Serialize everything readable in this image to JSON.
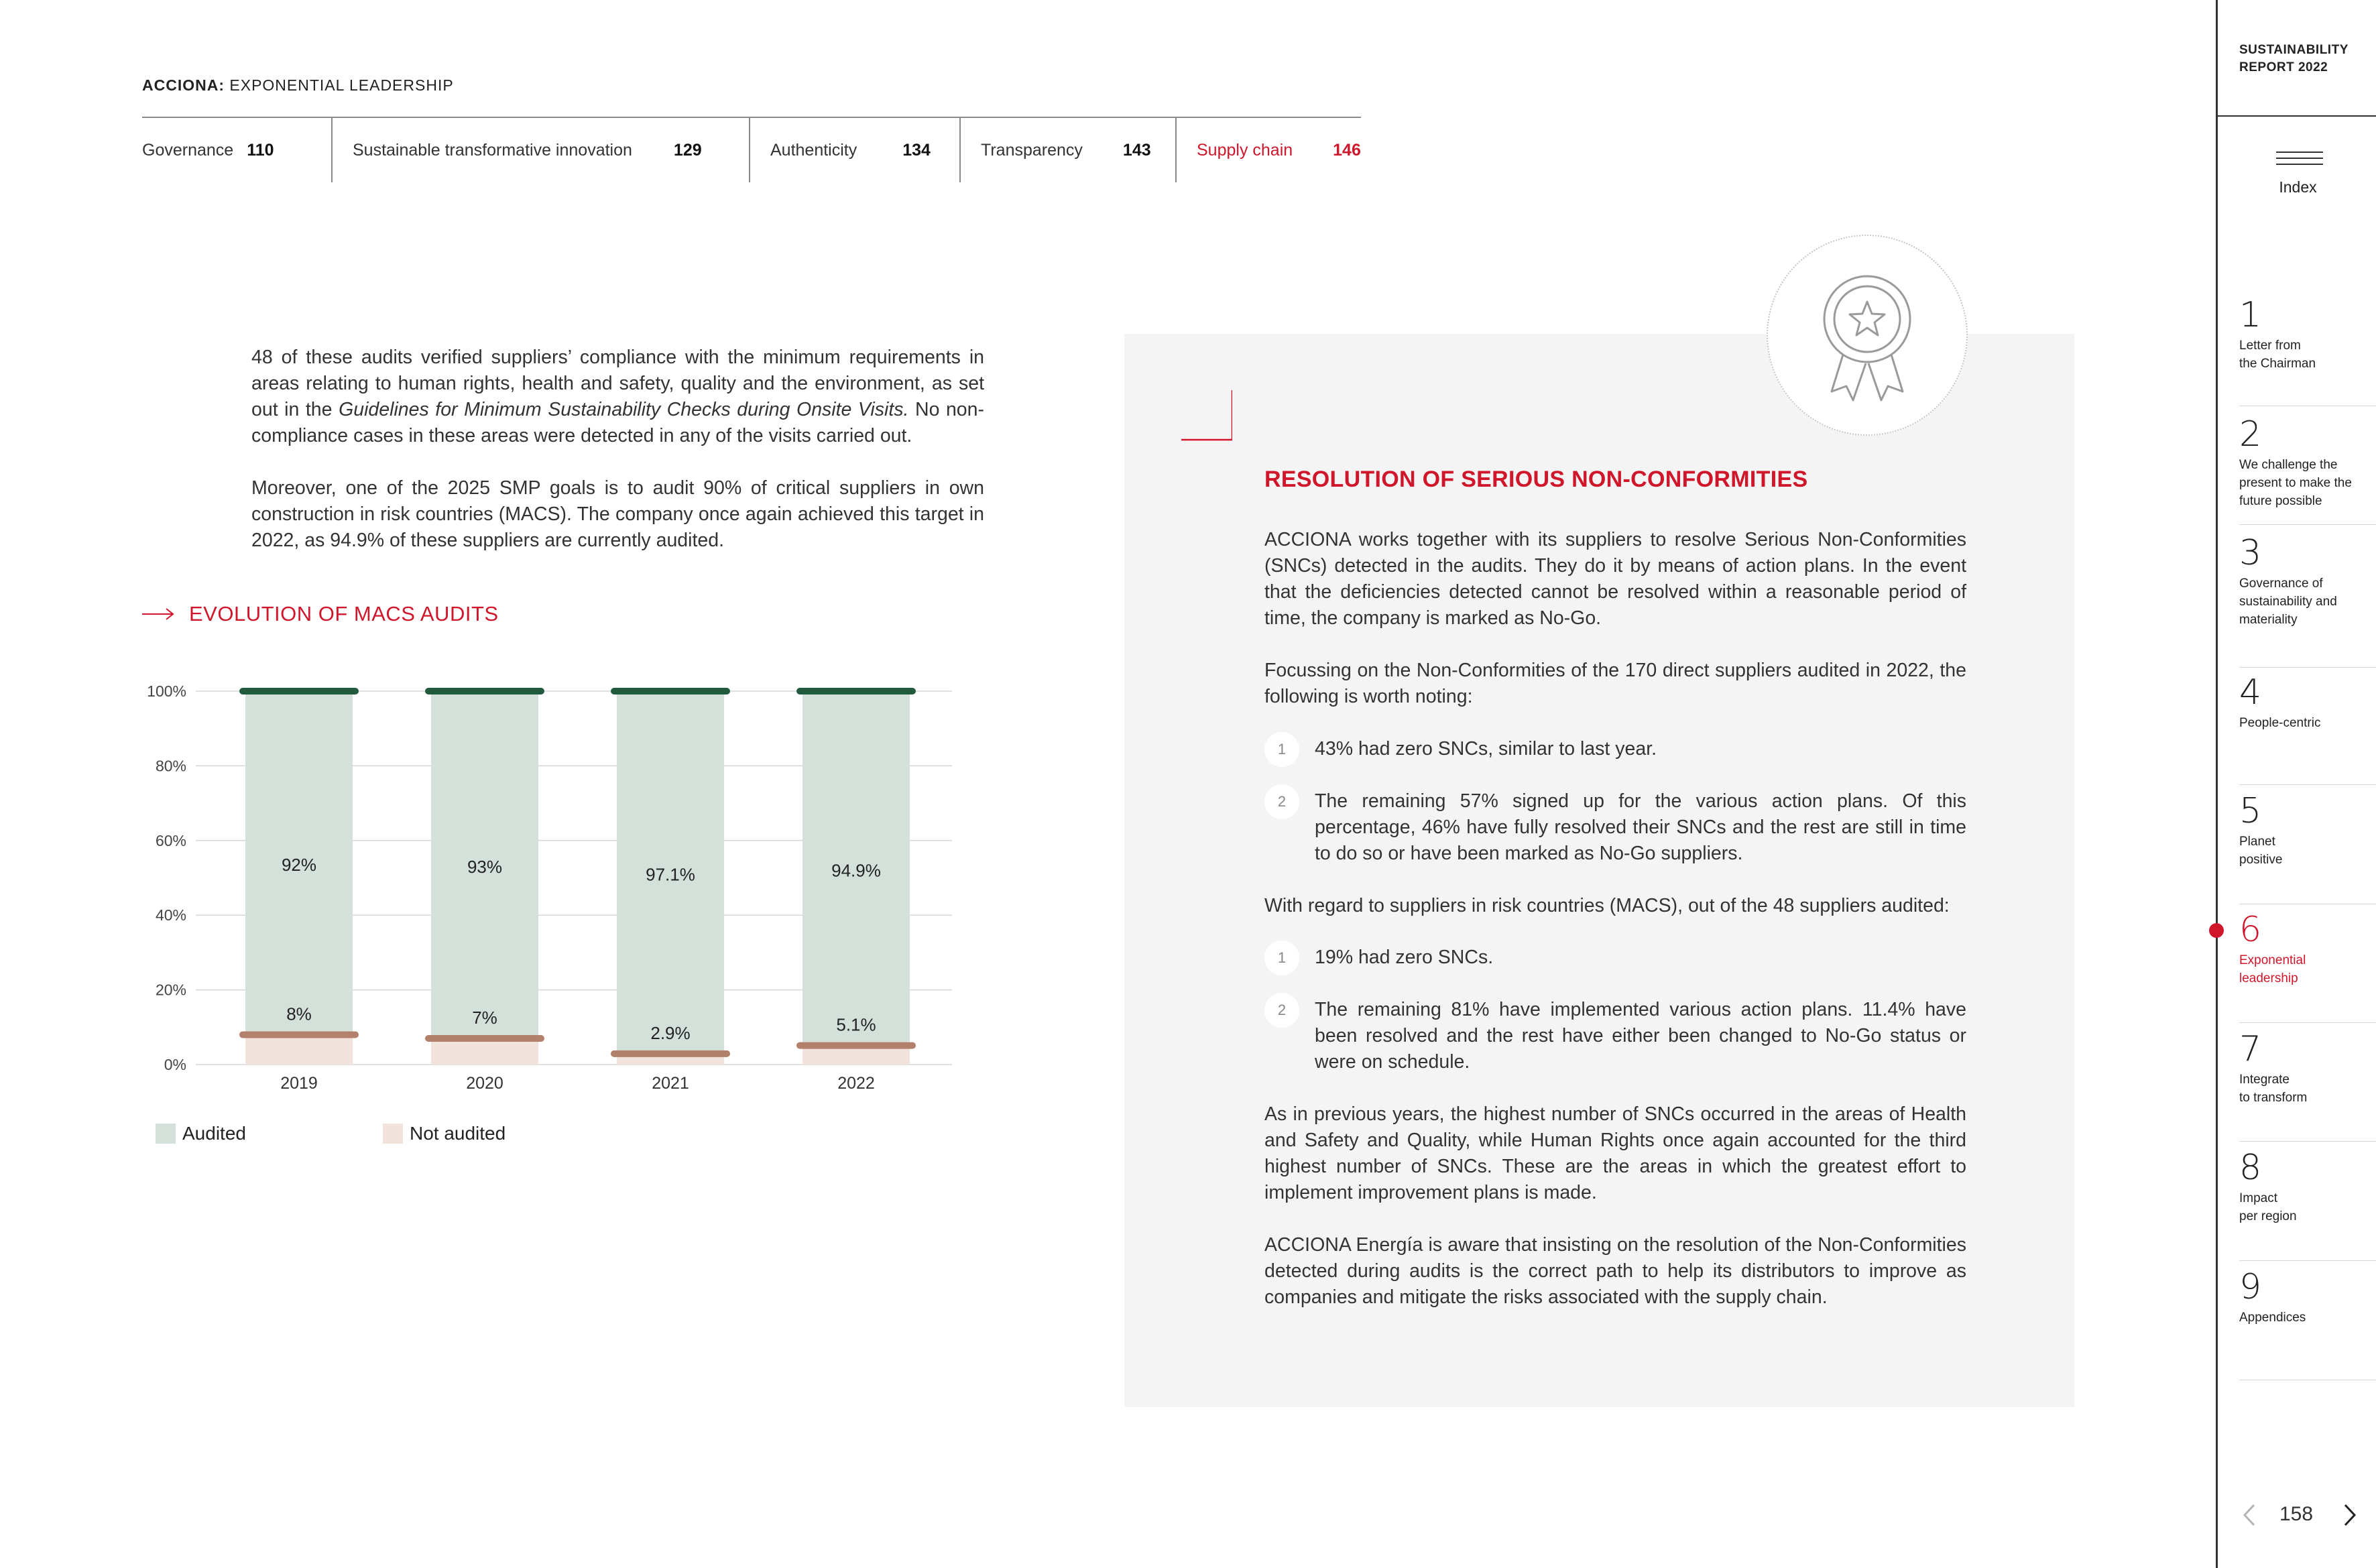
{
  "header": {
    "brand_bold": "ACCIONA:",
    "brand_rest": " EXPONENTIAL LEADERSHIP",
    "nav": [
      {
        "label": "Governance",
        "page": "110"
      },
      {
        "label": "Sustainable transformative innovation",
        "page": "129"
      },
      {
        "label": "Authenticity",
        "page": "134"
      },
      {
        "label": "Transparency",
        "page": "143"
      },
      {
        "label": "Supply chain",
        "page": "146"
      }
    ],
    "active_color": "#d0162b"
  },
  "left": {
    "para1_a": "48 of these audits verified suppliers’ compliance with the minimum requirements in areas relating to human rights, health and safety, quality and the environment, as set out in the ",
    "para1_italic": "Guidelines for Minimum Sustainability Checks during Onsite Visits.",
    "para1_b": " No non-compliance cases in these areas were detected in any of the visits carried out.",
    "para2": "Moreover, one of the 2025 SMP goals is to audit 90% of critical suppliers in own construction in risk countries (MACS). The company once again achieved this target in 2022, as 94.9% of these suppliers are currently audited.",
    "section_title": "EVOLUTION OF MACS AUDITS",
    "legend": {
      "audited": "Audited",
      "not_audited": "Not audited"
    }
  },
  "chart_data": {
    "type": "bar",
    "stacked": true,
    "categories": [
      "2019",
      "2020",
      "2021",
      "2022"
    ],
    "series": [
      {
        "name": "Audited",
        "values": [
          92,
          93,
          97.1,
          94.9
        ],
        "labels": [
          "92%",
          "93%",
          "97.1%",
          "94.9%"
        ],
        "color": "#d4e0da",
        "cap_color": "#225a3e"
      },
      {
        "name": "Not audited",
        "values": [
          8,
          7,
          2.9,
          5.1
        ],
        "labels": [
          "8%",
          "7%",
          "2.9%",
          "5.1%"
        ],
        "color": "#f2e2dc",
        "cap_color": "#b2806b"
      }
    ],
    "y_ticks": [
      "0%",
      "20%",
      "40%",
      "60%",
      "80%",
      "100%"
    ],
    "ylim": [
      0,
      100
    ],
    "grid": true,
    "legend_position": "bottom-left"
  },
  "box": {
    "title": "RESOLUTION OF SERIOUS NON-CONFORMITIES",
    "p1": "ACCIONA works together with its suppliers to resolve Serious Non-Conformities (SNCs) detected in the audits. They do it by means of action plans. In the event that the deficiencies detected cannot be resolved within a reasonable period of time, the company is marked as No-Go.",
    "p2": "Focussing on the Non-Conformities of the 170 direct suppliers audited in 2022, the following is worth noting:",
    "list1": [
      {
        "n": "1",
        "text": "43% had zero SNCs, similar to last year."
      },
      {
        "n": "2",
        "text": "The remaining 57% signed up for the various action plans. Of this percentage, 46% have fully resolved their SNCs and the rest are still in time to do so or have been marked as No-Go suppliers."
      }
    ],
    "p3": "With regard to suppliers in risk countries (MACS), out of the 48 suppliers audited:",
    "list2": [
      {
        "n": "1",
        "text": "19% had zero SNCs."
      },
      {
        "n": "2",
        "text": "The remaining 81% have implemented various action plans. 11.4% have been resolved and the rest have either been changed to No-Go status or were on schedule."
      }
    ],
    "p4": "As in previous years, the highest number of SNCs occurred in the areas of Health and Safety and Quality, while Human Rights once again accounted for the third highest number of SNCs. These are the areas in which the greatest effort to implement improvement plans is made.",
    "p5": "ACCIONA Energía is aware that insisting on the resolution of the Non-Conformities detected during audits is the correct path to help its distributors to improve as companies and mitigate the risks associated with the supply chain.",
    "badge_icon": "award-medal-icon"
  },
  "sidebar": {
    "title_line1": "SUSTAINABILITY",
    "title_line2": "REPORT 2022",
    "index_label": "Index",
    "chapters": [
      {
        "num": "1",
        "title": "Letter from\nthe Chairman"
      },
      {
        "num": "2",
        "title": "We challenge the\npresent to make the\nfuture possible"
      },
      {
        "num": "3",
        "title": "Governance of\nsustainability and\nmateriality"
      },
      {
        "num": "4",
        "title": "People-centric"
      },
      {
        "num": "5",
        "title": "Planet\npositive"
      },
      {
        "num": "6",
        "title": "Exponential\nleadership"
      },
      {
        "num": "7",
        "title": "Integrate\nto transform"
      },
      {
        "num": "8",
        "title": "Impact\nper region"
      },
      {
        "num": "9",
        "title": "Appendices"
      }
    ],
    "active_chapter": "6",
    "page_number": "158"
  }
}
